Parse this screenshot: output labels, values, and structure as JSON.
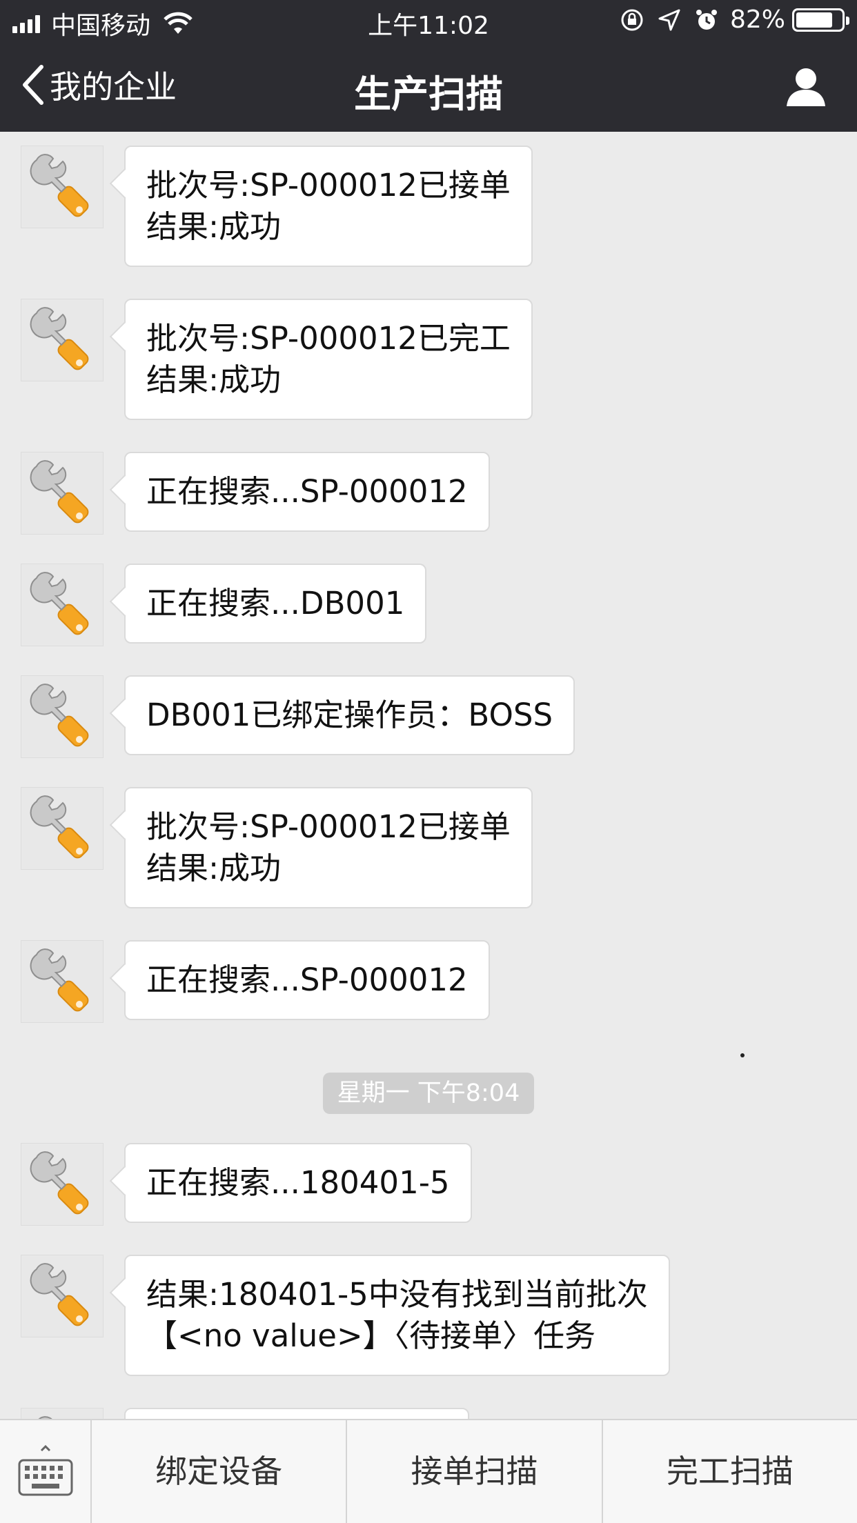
{
  "status_bar": {
    "carrier": "中国移动",
    "time": "上午11:02",
    "battery": "82%",
    "battery_level": 0.82
  },
  "nav": {
    "back_label": "我的企业",
    "title": "生产扫描"
  },
  "messages": [
    {
      "text": "批次号:SP-000012已接单\n结果:成功"
    },
    {
      "text": "批次号:SP-000012已完工\n结果:成功"
    },
    {
      "text": "正在搜索...SP-000012"
    },
    {
      "text": "正在搜索...DB001"
    },
    {
      "text": "DB001已绑定操作员：BOSS"
    },
    {
      "text": "批次号:SP-000012已接单\n结果:成功"
    },
    {
      "text": "正在搜索...SP-000012"
    },
    {
      "text": "正在搜索...180401-5"
    },
    {
      "text": "结果:180401-5中没有找到当前批次\n【<no value>】〈待接单〉任务"
    }
  ],
  "timestamp": "星期一 下午8:04",
  "bottom_bar": {
    "tabs": [
      "绑定设备",
      "接单扫描",
      "完工扫描"
    ]
  }
}
